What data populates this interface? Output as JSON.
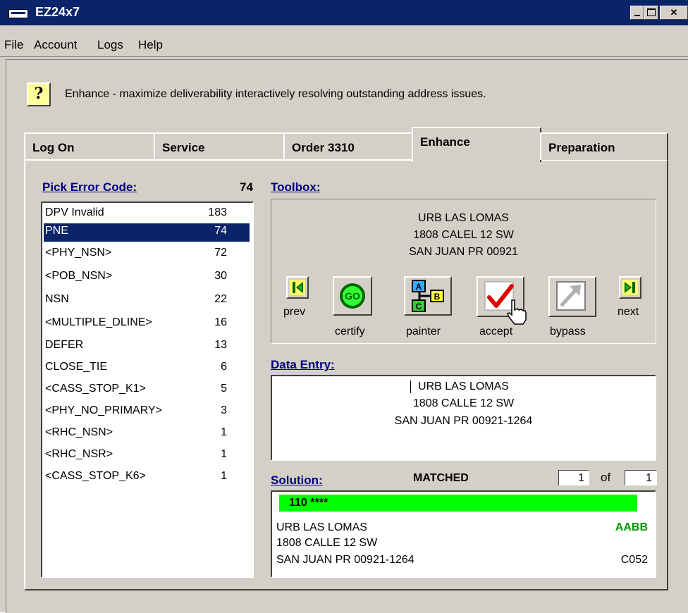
{
  "window": {
    "title": "EZ24x7"
  },
  "menu": [
    "File",
    "Account",
    "Logs",
    "Help"
  ],
  "help_text": "Enhance - maximize deliverability interactively resolving outstanding address issues.",
  "tabs": [
    "Log On",
    "Service",
    "Order 3310",
    "Enhance",
    "Preparation"
  ],
  "error_codes": {
    "header": "Pick Error Code:",
    "selected_count": "74",
    "items": [
      {
        "label": "DPV Invalid",
        "count": "183"
      },
      {
        "label": "PNE",
        "count": "74"
      },
      {
        "label": "<PHY_NSN>",
        "count": "72"
      },
      {
        "label": "<POB_NSN>",
        "count": "30"
      },
      {
        "label": "NSN",
        "count": "22"
      },
      {
        "label": "<MULTIPLE_DLINE>",
        "count": "16"
      },
      {
        "label": "DEFER",
        "count": "13"
      },
      {
        "label": "CLOSE_TIE",
        "count": "6"
      },
      {
        "label": "<CASS_STOP_K1>",
        "count": "5"
      },
      {
        "label": "<PHY_NO_PRIMARY>",
        "count": "3"
      },
      {
        "label": "<RHC_NSN>",
        "count": "1"
      },
      {
        "label": "<RHC_NSR>",
        "count": "1"
      },
      {
        "label": "<CASS_STOP_K6>",
        "count": "1"
      }
    ]
  },
  "toolbox": {
    "header": "Toolbox:",
    "address": [
      "URB LAS LOMAS",
      "1808 CALEL 12 SW",
      "SAN JUAN PR 00921"
    ],
    "buttons": {
      "prev": "prev",
      "certify": "certify",
      "painter": "painter",
      "accept": "accept",
      "bypass": "bypass",
      "next": "next"
    },
    "certify_icon_text": "GO",
    "painter_letters": [
      "A",
      "B",
      "C"
    ]
  },
  "data_entry": {
    "header": "Data Entry:",
    "lines": [
      "URB LAS LOMAS",
      "1808 CALLE 12 SW",
      "SAN JUAN PR 00921-1264"
    ]
  },
  "solution": {
    "header": "Solution:",
    "status": "MATCHED",
    "current": "1",
    "of_label": "of",
    "total": "1",
    "score": "110 ****",
    "code1": "AABB",
    "code2": "C052",
    "lines": [
      "URB LAS LOMAS",
      "1808 CALLE 12 SW",
      "SAN JUAN PR 00921-1264"
    ],
    "colors": {
      "score_bar": "#00ff00",
      "code1": "#009900"
    }
  }
}
